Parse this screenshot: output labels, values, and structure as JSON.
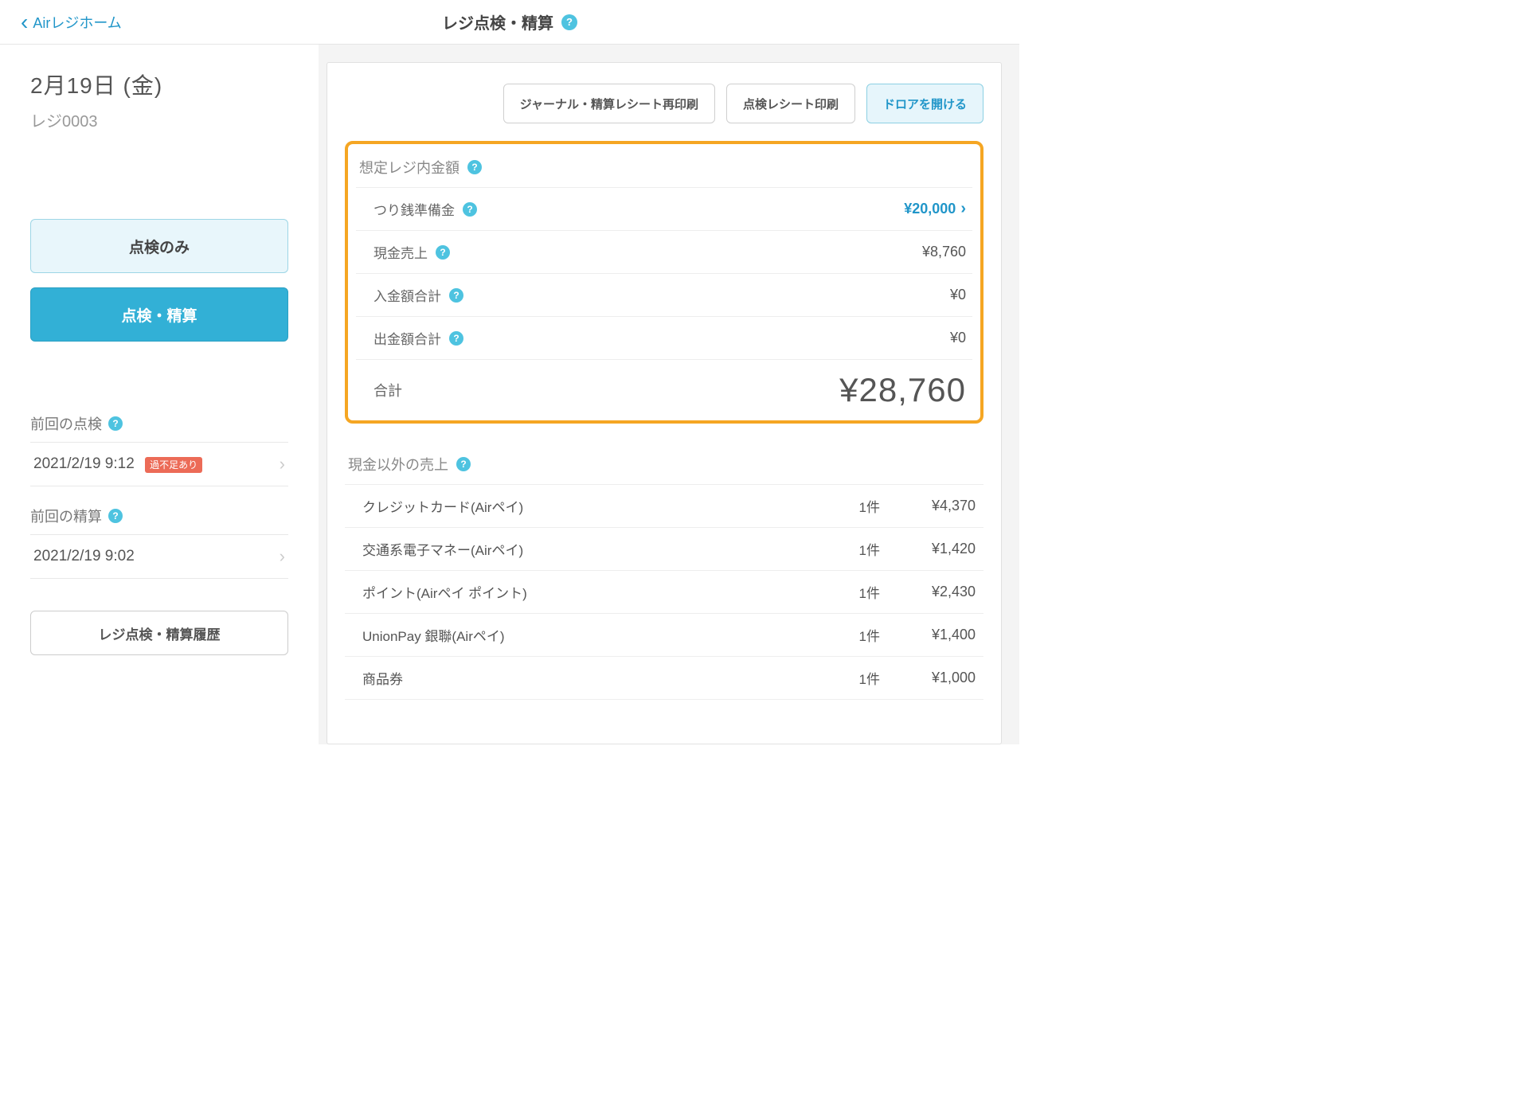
{
  "header": {
    "back_label": "Airレジホーム",
    "title": "レジ点検・精算"
  },
  "sidebar": {
    "date": "2月19日 (金)",
    "register": "レジ0003",
    "btn_check_only": "点検のみ",
    "btn_check_settle": "点検・精算",
    "last_check_label": "前回の点検",
    "last_check_time": "2021/2/19 9:12",
    "last_check_badge": "過不足あり",
    "last_settle_label": "前回の精算",
    "last_settle_time": "2021/2/19 9:02",
    "history_button": "レジ点検・精算履歴"
  },
  "toolbar": {
    "journal_reprint": "ジャーナル・精算レシート再印刷",
    "print_check": "点検レシート印刷",
    "open_drawer": "ドロアを開ける"
  },
  "expected": {
    "title": "想定レジ内金額",
    "change_fund_label": "つり銭準備金",
    "change_fund_value": "¥20,000",
    "cash_sales_label": "現金売上",
    "cash_sales_value": "¥8,760",
    "deposit_label": "入金額合計",
    "deposit_value": "¥0",
    "withdraw_label": "出金額合計",
    "withdraw_value": "¥0",
    "total_label": "合計",
    "total_value": "¥28,760"
  },
  "noncash": {
    "title": "現金以外の売上",
    "rows": [
      {
        "label": "クレジットカード(Airペイ)",
        "count": "1件",
        "value": "¥4,370"
      },
      {
        "label": "交通系電子マネー(Airペイ)",
        "count": "1件",
        "value": "¥1,420"
      },
      {
        "label": "ポイント(Airペイ ポイント)",
        "count": "1件",
        "value": "¥2,430"
      },
      {
        "label": "UnionPay 銀聯(Airペイ)",
        "count": "1件",
        "value": "¥1,400"
      },
      {
        "label": "商品券",
        "count": "1件",
        "value": "¥1,000"
      }
    ]
  }
}
